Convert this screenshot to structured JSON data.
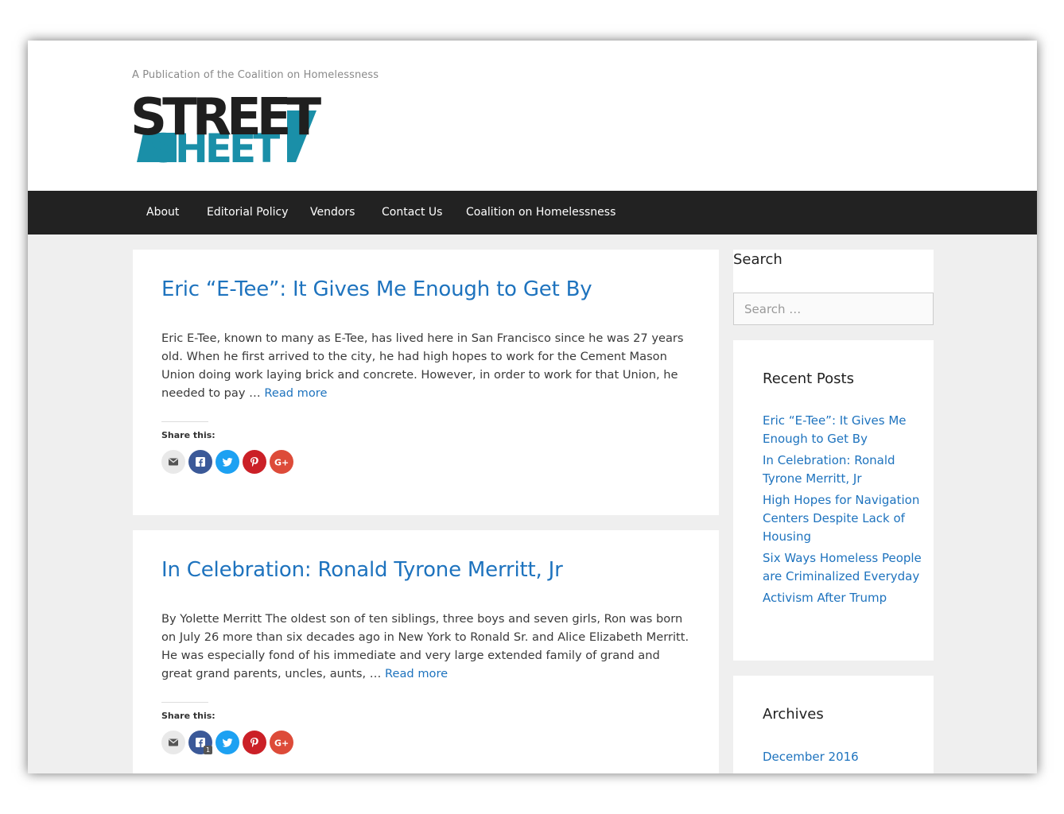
{
  "site": {
    "tagline": "A Publication of the Coalition on Homelessness",
    "logo_top": "STREET",
    "logo_bottom": "SHEET"
  },
  "nav": {
    "items": [
      {
        "label": "About"
      },
      {
        "label": "Editorial Policy"
      },
      {
        "label": "Vendors"
      },
      {
        "label": "Contact Us"
      },
      {
        "label": "Coalition on Homelessness"
      }
    ]
  },
  "posts": [
    {
      "title": "Eric “E-Tee”: It Gives Me Enough to Get By",
      "excerpt": "Eric E-Tee, known to many as E-Tee, has lived here in San Francisco since he was 27 years old. When he first arrived to the city, he had high hopes to work for the Cement Mason Union doing work laying brick and concrete. However, in order to work for that Union, he needed to pay … ",
      "read_more": "Read more",
      "share_label": "Share this:"
    },
    {
      "title": "In Celebration: Ronald Tyrone Merritt, Jr",
      "excerpt": "By Yolette Merritt The oldest son of ten siblings, three boys and seven girls, Ron was born on July 26 more than six decades ago in New York to Ronald Sr. and Alice Elizabeth Merritt. He was especially fond of his immediate and very large extended family of grand and great grand parents, uncles, aunts, … ",
      "read_more": "Read more",
      "share_label": "Share this:",
      "facebook_count": "1"
    }
  ],
  "share_buttons": [
    {
      "icon": "email-icon",
      "color": "#e9e9e9"
    },
    {
      "icon": "facebook-icon",
      "color": "#3b5998"
    },
    {
      "icon": "twitter-icon",
      "color": "#1da1f2"
    },
    {
      "icon": "pinterest-icon",
      "color": "#cb2027"
    },
    {
      "icon": "google-plus-icon",
      "color": "#dd4b39"
    }
  ],
  "sidebar": {
    "search": {
      "title": "Search",
      "placeholder": "Search …"
    },
    "recent": {
      "title": "Recent Posts",
      "items": [
        "Eric “E-Tee”: It Gives Me Enough to Get By",
        "In Celebration: Ronald Tyrone Merritt, Jr",
        "High Hopes for Navigation Centers Despite Lack of Housing",
        "Six Ways Homeless People are Criminalized Everyday",
        "Activism After Trump"
      ]
    },
    "archives": {
      "title": "Archives",
      "items": [
        "December 2016"
      ]
    }
  },
  "colors": {
    "link": "#1e73be",
    "nav_bg": "#222222",
    "logo_teal": "#1a8fa8",
    "logo_black": "#1f1f1f"
  }
}
